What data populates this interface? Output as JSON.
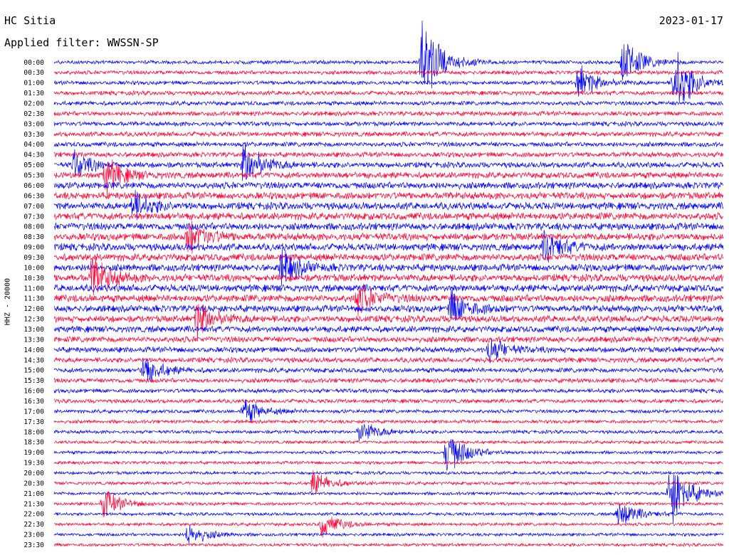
{
  "header": {
    "station": "HC Sitia",
    "date": "2023-01-17",
    "filter": "Applied filter: WWSSN-SP",
    "channel": "HHZ - 20000"
  },
  "colors": {
    "background": "#ffffff",
    "trace_a": "#0000ff",
    "trace_b": "#ff0033",
    "text": "#000000"
  },
  "chart_data": {
    "type": "helicorder",
    "ylabel": "HHZ - 20000",
    "time_labels": [
      "00:00",
      "00:30",
      "01:00",
      "01:30",
      "02:00",
      "02:30",
      "03:00",
      "03:30",
      "04:00",
      "04:30",
      "05:00",
      "05:30",
      "06:00",
      "06:30",
      "07:00",
      "07:30",
      "08:00",
      "08:30",
      "09:00",
      "09:30",
      "10:00",
      "10:30",
      "11:00",
      "11:30",
      "12:00",
      "12:30",
      "13:00",
      "13:30",
      "14:00",
      "14:30",
      "15:00",
      "15:30",
      "16:00",
      "16:30",
      "17:00",
      "17:30",
      "18:00",
      "18:30",
      "19:00",
      "19:30",
      "20:00",
      "20:30",
      "21:00",
      "21:30",
      "22:00",
      "22:30",
      "23:00",
      "23:30"
    ],
    "row_minutes": 30,
    "series_colors": [
      "#0000ff",
      "#ff0033"
    ],
    "noise_level_per_row": [
      0.35,
      0.4,
      0.4,
      0.45,
      0.45,
      0.5,
      0.5,
      0.55,
      0.55,
      0.6,
      0.7,
      0.8,
      0.9,
      0.95,
      1.0,
      1.0,
      1.0,
      1.0,
      1.0,
      1.0,
      1.0,
      1.0,
      1.0,
      1.0,
      0.95,
      0.9,
      0.85,
      0.75,
      0.7,
      0.6,
      0.55,
      0.5,
      0.45,
      0.4,
      0.35,
      0.3,
      0.3,
      0.25,
      0.25,
      0.25,
      0.25,
      0.25,
      0.25,
      0.25,
      0.25,
      0.25,
      0.25,
      0.25
    ],
    "events": [
      {
        "row": 0,
        "minute": 25.5,
        "amplitude": 4.0
      },
      {
        "row": 0,
        "minute": 16.5,
        "amplitude": 8.0
      },
      {
        "row": 2,
        "minute": 27.8,
        "amplitude": 6.0
      },
      {
        "row": 2,
        "minute": 23.5,
        "amplitude": 3.0
      },
      {
        "row": 10,
        "minute": 0.9,
        "amplitude": 2.2
      },
      {
        "row": 10,
        "minute": 8.5,
        "amplitude": 4.0
      },
      {
        "row": 11,
        "minute": 2.3,
        "amplitude": 3.0
      },
      {
        "row": 14,
        "minute": 3.5,
        "amplitude": 2.5
      },
      {
        "row": 17,
        "minute": 6.0,
        "amplitude": 3.0
      },
      {
        "row": 18,
        "minute": 22.0,
        "amplitude": 2.8
      },
      {
        "row": 20,
        "minute": 10.2,
        "amplitude": 3.0
      },
      {
        "row": 21,
        "minute": 1.7,
        "amplitude": 3.5
      },
      {
        "row": 23,
        "minute": 13.6,
        "amplitude": 2.5
      },
      {
        "row": 24,
        "minute": 17.8,
        "amplitude": 3.0
      },
      {
        "row": 25,
        "minute": 6.4,
        "amplitude": 3.0
      },
      {
        "row": 28,
        "minute": 19.5,
        "amplitude": 2.0
      },
      {
        "row": 30,
        "minute": 4.0,
        "amplitude": 2.5
      },
      {
        "row": 34,
        "minute": 8.5,
        "amplitude": 2.2
      },
      {
        "row": 36,
        "minute": 13.7,
        "amplitude": 2.0
      },
      {
        "row": 38,
        "minute": 17.6,
        "amplitude": 4.0
      },
      {
        "row": 41,
        "minute": 11.6,
        "amplitude": 2.0
      },
      {
        "row": 42,
        "minute": 27.6,
        "amplitude": 6.0
      },
      {
        "row": 43,
        "minute": 2.2,
        "amplitude": 2.5
      },
      {
        "row": 44,
        "minute": 25.3,
        "amplitude": 2.5
      },
      {
        "row": 45,
        "minute": 12.0,
        "amplitude": 2.0
      },
      {
        "row": 46,
        "minute": 6.0,
        "amplitude": 2.0
      }
    ]
  }
}
